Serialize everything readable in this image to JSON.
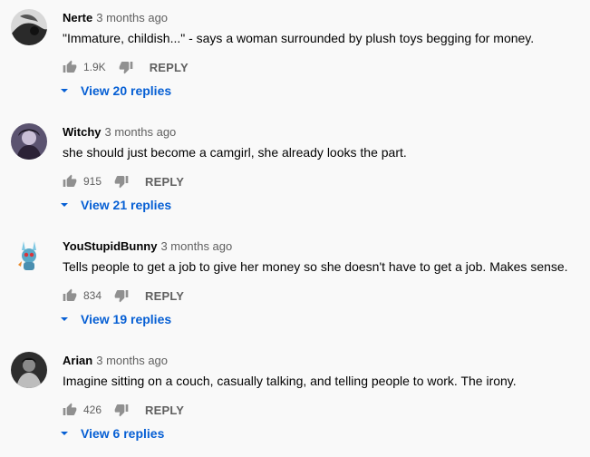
{
  "colors": {
    "background": "#f9f9f9",
    "text_primary": "#030303",
    "text_secondary": "#606060",
    "link_blue": "#065fd4",
    "icon_gray": "#909090"
  },
  "icons": {
    "like": "thumb-up-icon",
    "dislike": "thumb-down-icon",
    "expand": "caret-down-icon"
  },
  "comments": [
    {
      "author": "Nerte",
      "time": "3 months ago",
      "text": "\"Immature, childish...\" - says a woman surrounded by plush toys begging for money.",
      "likes": "1.9K",
      "reply_label": "REPLY",
      "replies_label": "View 20 replies"
    },
    {
      "author": "Witchy",
      "time": "3 months ago",
      "text": "she should just become a camgirl, she already looks the part.",
      "likes": "915",
      "reply_label": "REPLY",
      "replies_label": "View 21 replies"
    },
    {
      "author": "YouStupidBunny",
      "time": "3 months ago",
      "text": "Tells people to get a job to give her money so she doesn't have  to get a job.  Makes sense.",
      "likes": "834",
      "reply_label": "REPLY",
      "replies_label": "View 19 replies"
    },
    {
      "author": "Arian",
      "time": "3 months ago",
      "text": "Imagine sitting on a couch, casually talking, and telling people to work. The irony.",
      "likes": "426",
      "reply_label": "REPLY",
      "replies_label": "View 6 replies"
    }
  ]
}
